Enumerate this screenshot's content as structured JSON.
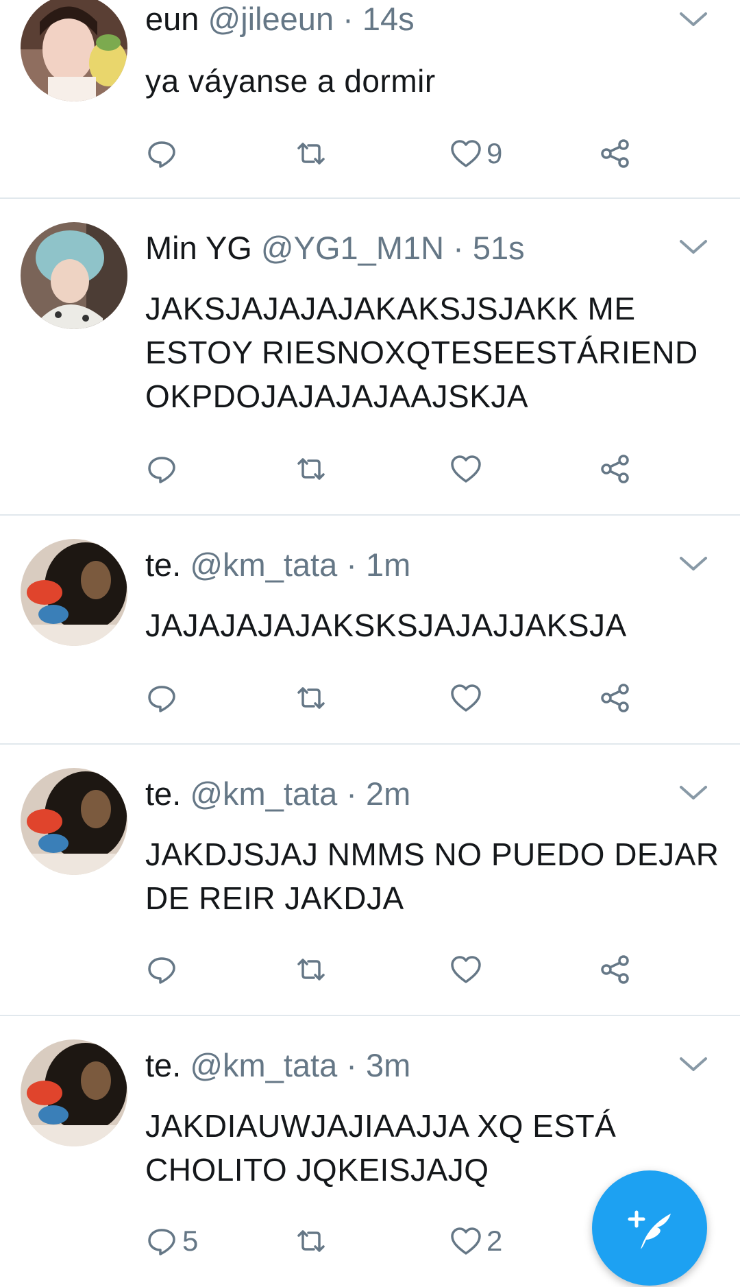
{
  "colors": {
    "accent": "#1da1f2",
    "secondary_text": "#657786",
    "divider": "#e1e8ed"
  },
  "tweets": [
    {
      "name": "eun",
      "handle": "@jileeun",
      "dot": "·",
      "time": "14s",
      "text": "ya váyanse a dormir",
      "reply_count": "",
      "retweet_count": "",
      "like_count": "9"
    },
    {
      "name": "Min YG",
      "handle": "@YG1_M1N",
      "dot": "·",
      "time": "51s",
      "text": "JAKSJAJAJAJAKAKSJSJAKK ME ESTOY RIESNOXQTESEESTÁRIEND OKPDOJAJAJAJAAJSKJA",
      "reply_count": "",
      "retweet_count": "",
      "like_count": ""
    },
    {
      "name": "te.",
      "handle": "@km_tata",
      "dot": "·",
      "time": "1m",
      "text": "JAJAJAJAJAKSKSJAJAJJAKSJA",
      "reply_count": "",
      "retweet_count": "",
      "like_count": ""
    },
    {
      "name": "te.",
      "handle": "@km_tata",
      "dot": "·",
      "time": "2m",
      "text": "JAKDJSJAJ NMMS NO PUEDO DEJAR DE REIR JAKDJA",
      "reply_count": "",
      "retweet_count": "",
      "like_count": ""
    },
    {
      "name": "te.",
      "handle": "@km_tata",
      "dot": "·",
      "time": "3m",
      "text": "JAKDIAUWJAJIAAJJA XQ ESTÁ CHOLITO JQKEISJAJQ",
      "reply_count": "5",
      "retweet_count": "",
      "like_count": "2"
    }
  ]
}
